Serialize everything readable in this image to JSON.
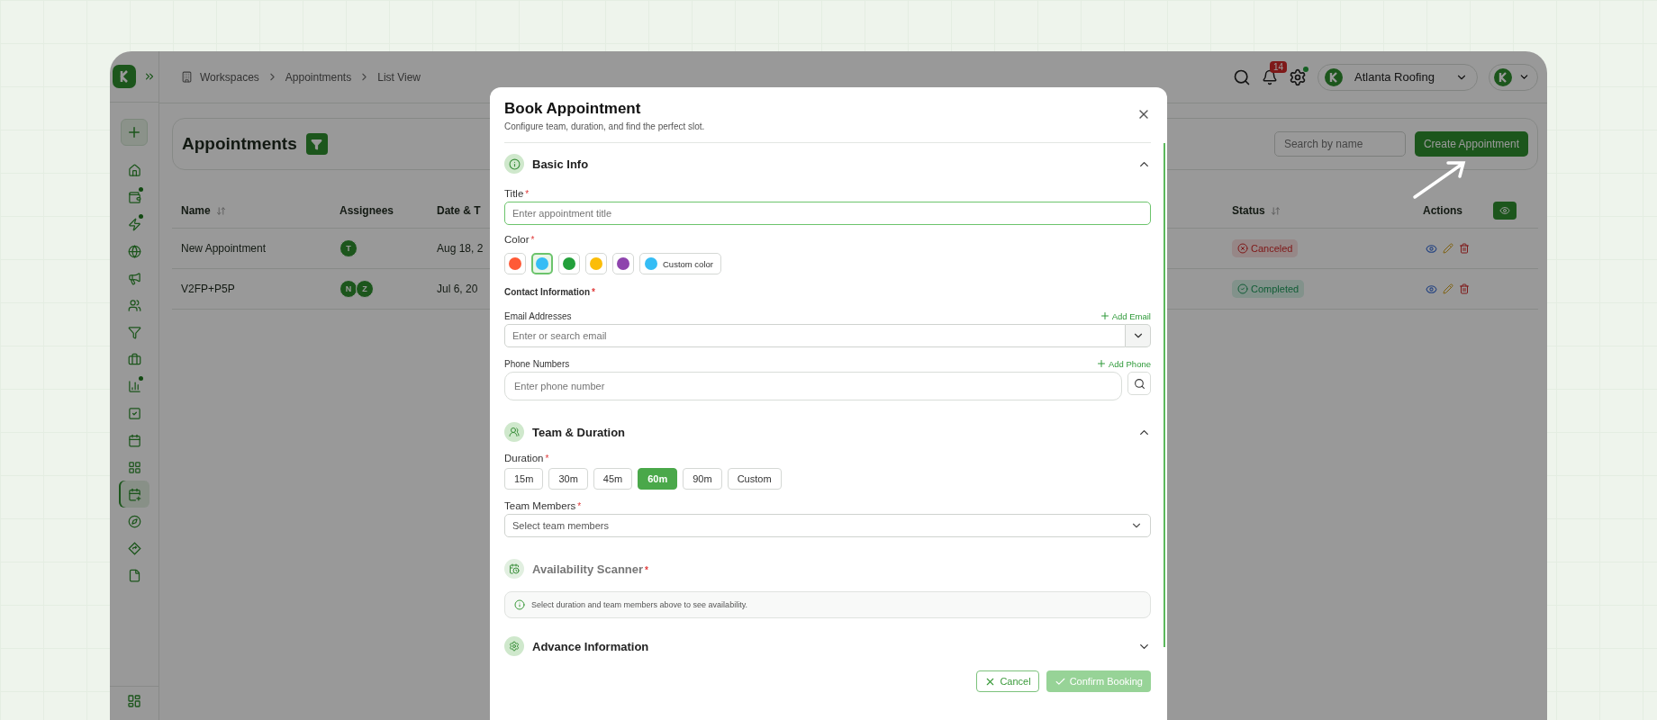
{
  "sidebar": {
    "items": [
      {
        "selected": false,
        "badge": false
      },
      {
        "selected": false,
        "badge": true
      },
      {
        "selected": false,
        "badge": true
      },
      {
        "selected": false,
        "badge": false
      },
      {
        "selected": false,
        "badge": false
      },
      {
        "selected": false,
        "badge": false
      },
      {
        "selected": false,
        "badge": false
      },
      {
        "selected": false,
        "badge": false
      },
      {
        "selected": false,
        "badge": true
      },
      {
        "selected": false,
        "badge": false
      },
      {
        "selected": false,
        "badge": false
      },
      {
        "selected": false,
        "badge": false
      },
      {
        "selected": true,
        "badge": false
      },
      {
        "selected": false,
        "badge": false
      },
      {
        "selected": false,
        "badge": false
      },
      {
        "selected": false,
        "badge": false
      }
    ]
  },
  "breadcrumb": [
    "Workspaces",
    "Appointments",
    "List View"
  ],
  "header": {
    "notifications": "14",
    "settings_badge": true,
    "organization": "Atlanta Roofing"
  },
  "page": {
    "title": "Appointments",
    "search": {
      "placeholder": "Search by name"
    },
    "create_button": "Create Appointment"
  },
  "table": {
    "columns": [
      {
        "label": "Name",
        "sortable": true
      },
      {
        "label": "Assignees",
        "sortable": false
      },
      {
        "label": "Date & T",
        "sortable": false
      },
      {
        "label": "Status",
        "sortable": true
      },
      {
        "label": "Actions",
        "sortable": false
      }
    ],
    "rows": [
      {
        "name": "New Appointment",
        "assignees": [
          "T"
        ],
        "date": "Aug 18, 2",
        "status": {
          "label": "Canceled",
          "kind": "canceled"
        }
      },
      {
        "name": "V2FP+P5P",
        "assignees": [
          "N",
          "Z"
        ],
        "date": "Jul 6, 20",
        "status": {
          "label": "Completed",
          "kind": "completed"
        }
      }
    ]
  },
  "modal": {
    "title": "Book Appointment",
    "subtitle": "Configure team, duration, and find the perfect slot.",
    "basic_info": {
      "title": "Basic Info",
      "expanded": true,
      "title_field": {
        "label": "Title",
        "required_mark": "*",
        "placeholder": "Enter appointment title"
      },
      "color": {
        "label": "Color",
        "required_mark": "*",
        "swatches": [
          {
            "color": "#ff5a36",
            "selected": false
          },
          {
            "color": "#35bdf5",
            "selected": true
          },
          {
            "color": "#23a03b",
            "selected": false
          },
          {
            "color": "#fbbd08",
            "selected": false
          },
          {
            "color": "#8e44ad",
            "selected": false
          }
        ],
        "custom": {
          "label": "Custom color",
          "color": "#35bdf5"
        }
      },
      "contact": {
        "label": "Contact Information",
        "required_mark": "*",
        "email": {
          "label": "Email Addresses",
          "add": "Add Email",
          "placeholder": "Enter or search email"
        },
        "phone": {
          "label": "Phone Numbers",
          "add": "Add Phone",
          "placeholder": "Enter phone number"
        }
      }
    },
    "team_duration": {
      "title": "Team & Duration",
      "expanded": true,
      "duration": {
        "label": "Duration",
        "required_mark": "*",
        "options": [
          {
            "label": "15m",
            "selected": false
          },
          {
            "label": "30m",
            "selected": false
          },
          {
            "label": "45m",
            "selected": false
          },
          {
            "label": "60m",
            "selected": true
          },
          {
            "label": "90m",
            "selected": false
          },
          {
            "label": "Custom",
            "selected": false
          }
        ]
      },
      "team": {
        "label": "Team Members",
        "required_mark": "*",
        "placeholder": "Select team members"
      }
    },
    "availability": {
      "title": "Availability Scanner",
      "required_mark": "*",
      "disabled": true,
      "message": "Select duration and team members above to see availability."
    },
    "advance": {
      "title": "Advance Information",
      "expanded": false
    },
    "cancel": "Cancel",
    "confirm": {
      "label": "Confirm Booking",
      "disabled": true
    }
  }
}
